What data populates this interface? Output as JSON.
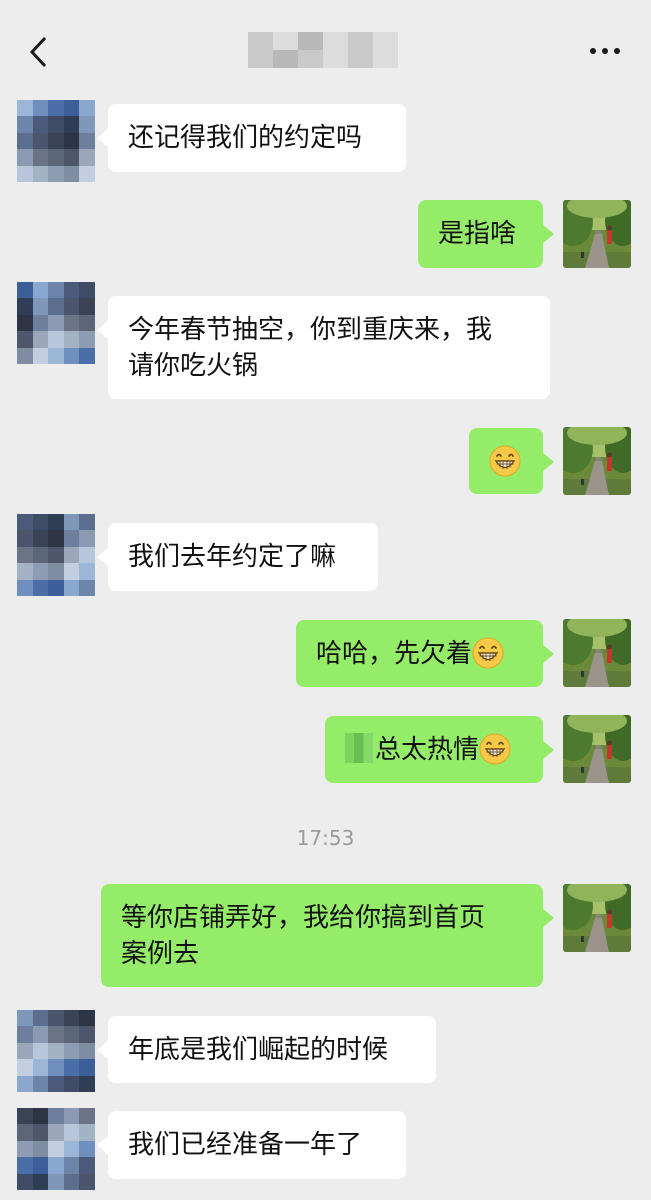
{
  "header": {
    "back_icon": "chevron-left-icon",
    "more_icon": "more-dots-icon"
  },
  "messages": [
    {
      "side": "left",
      "text": "还记得我们的约定吗"
    },
    {
      "side": "right",
      "text": "是指啥"
    },
    {
      "side": "left",
      "line1": "今年春节抽空，你到重庆来，我",
      "line2": "请你吃火锅"
    },
    {
      "side": "right",
      "emoji": "grinning-face-emoji"
    },
    {
      "side": "left",
      "text": "我们去年约定了嘛"
    },
    {
      "side": "right",
      "text": "哈哈，先欠着",
      "emoji": "grinning-face-emoji"
    },
    {
      "side": "right",
      "text": "总太热情",
      "emoji": "grinning-face-emoji"
    },
    {
      "side": "right",
      "line1": "等你店铺弄好，我给你搞到首页",
      "line2": "案例去"
    },
    {
      "side": "left",
      "text": "年底是我们崛起的时候"
    },
    {
      "side": "left",
      "text": "我们已经准备一年了"
    }
  ],
  "timestamp": "17:53",
  "colors": {
    "background": "#ededed",
    "bubble_sent": "#95ec69",
    "bubble_received": "#ffffff"
  }
}
